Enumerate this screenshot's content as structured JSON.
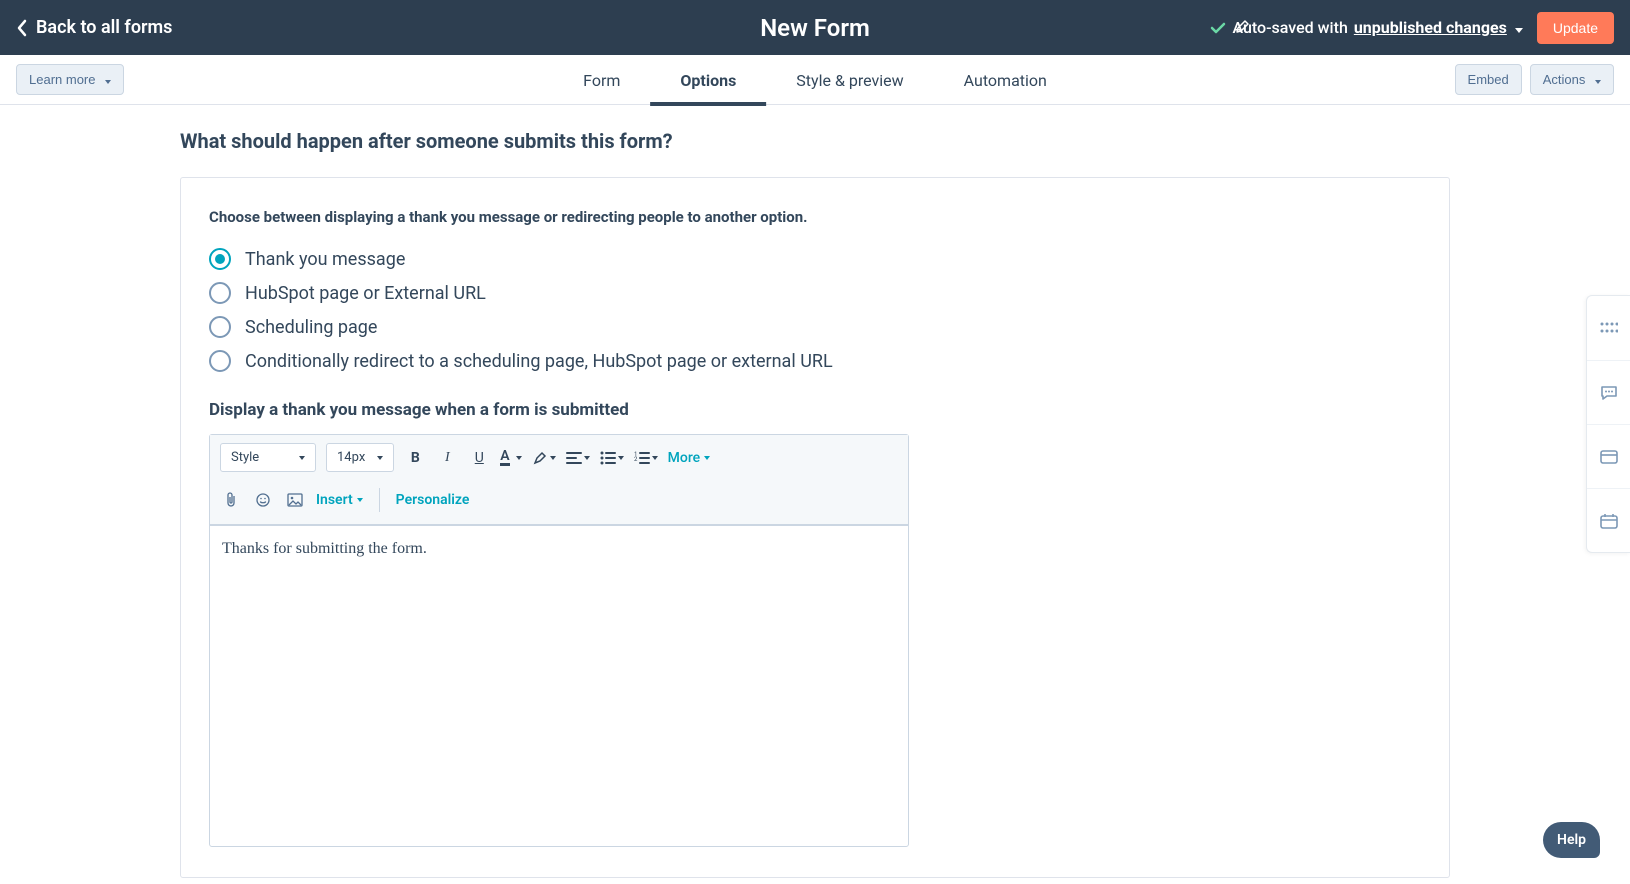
{
  "header": {
    "back_label": "Back to all forms",
    "form_title": "New Form",
    "autosave_prefix": "Auto-saved with ",
    "autosave_link": "unpublished changes",
    "update_label": "Update"
  },
  "subbar": {
    "learn_more": "Learn more",
    "tabs": [
      "Form",
      "Options",
      "Style & preview",
      "Automation"
    ],
    "active_tab": 1,
    "embed": "Embed",
    "actions": "Actions"
  },
  "content": {
    "heading": "What should happen after someone submits this form?",
    "choose_label": "Choose between displaying a thank you message or redirecting people to another option.",
    "radio_options": [
      "Thank you message",
      "HubSpot page or External URL",
      "Scheduling page",
      "Conditionally redirect to a scheduling page, HubSpot page or external URL"
    ],
    "selected_radio": 0,
    "display_heading": "Display a thank you message when a form is submitted"
  },
  "editor": {
    "style_label": "Style",
    "font_size": "14px",
    "more_label": "More",
    "insert_label": "Insert",
    "personalize_label": "Personalize",
    "body_text": "Thanks for submitting the form."
  },
  "help_label": "Help"
}
